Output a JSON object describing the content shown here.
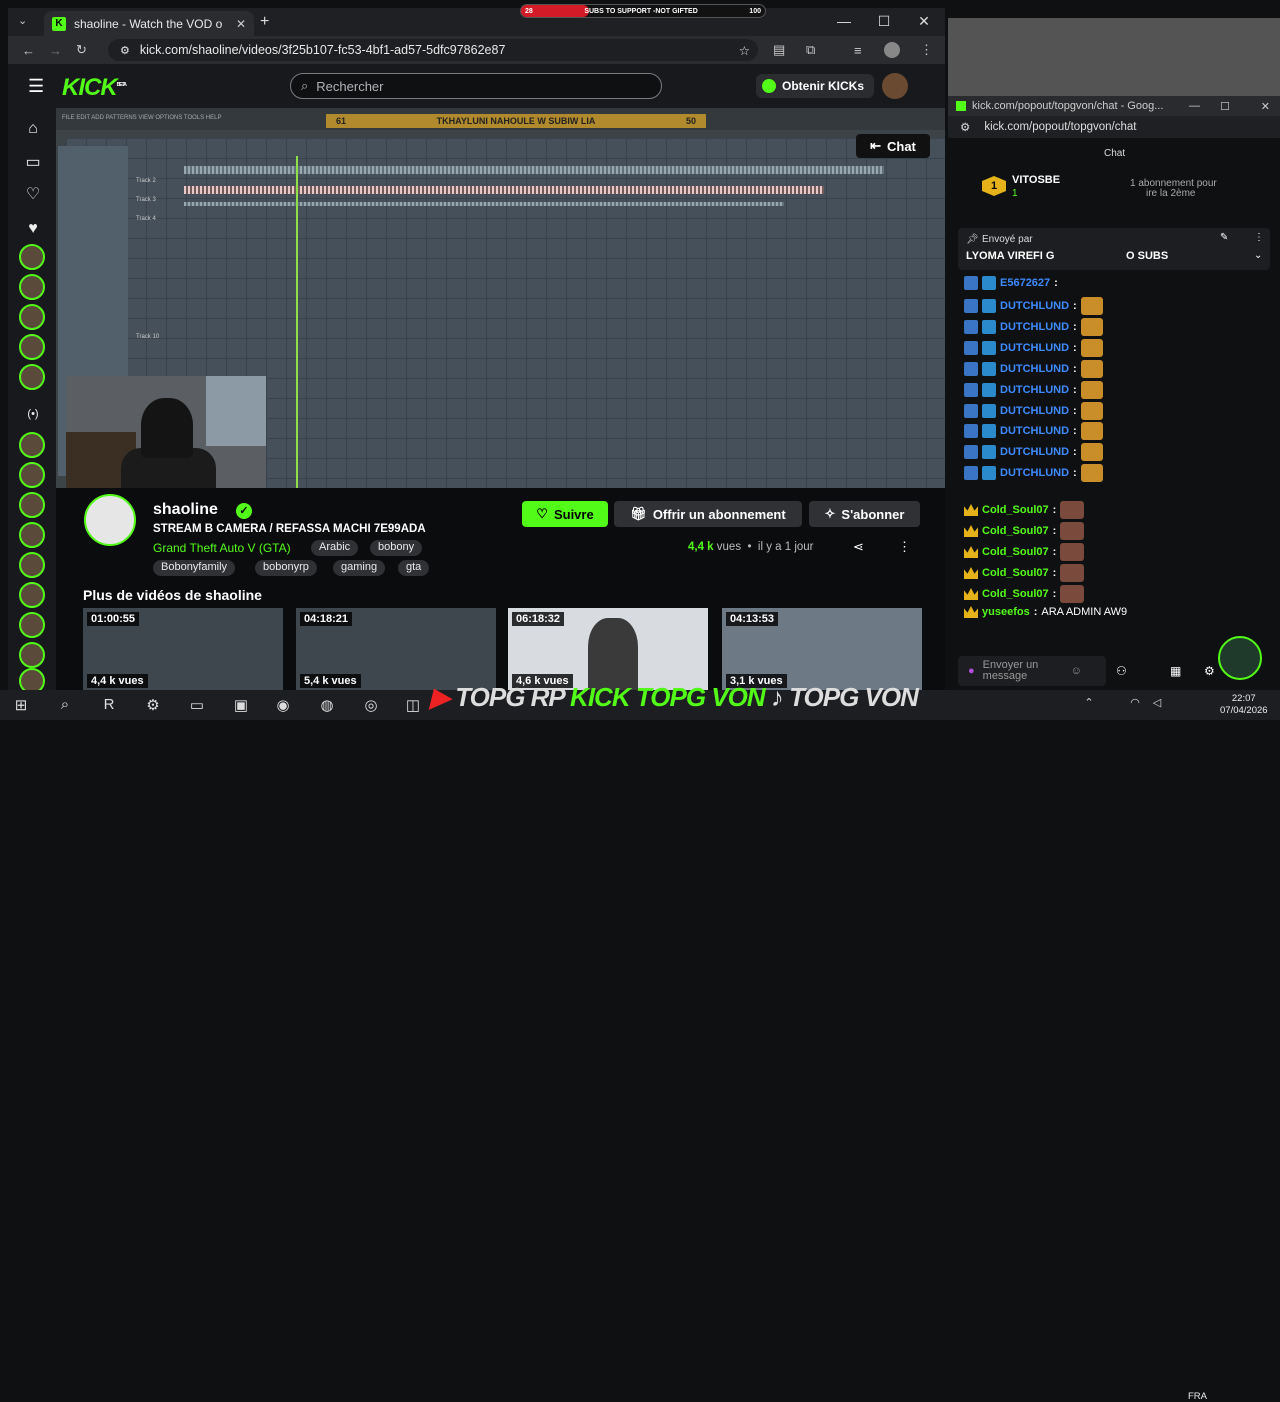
{
  "overlay": {
    "sub_goal_left": "28",
    "sub_goal_text": "SUBS TO SUPPORT -NOT GIFTED",
    "sub_goal_right": "100",
    "sub_progress": 0.28
  },
  "browser": {
    "tab_title": "shaoline - Watch the VOD o",
    "url": "kick.com/shaoline/videos/3f25b107-fc53-4bf1-ad57-5dfc97862e87"
  },
  "kick": {
    "logo": "KICK",
    "logo_beta": "BETA",
    "search_placeholder": "Rechercher",
    "get_kicks": "Obtenir KICKs"
  },
  "video": {
    "banner_left": "61",
    "banner_text": "TKHAYLUNI NAHOULE W SUBIW LIA",
    "banner_right": "50",
    "chat_button": "Chat",
    "track_labels": [
      "Track 2",
      "Track 3",
      "Track 4",
      "Track 10"
    ]
  },
  "channel": {
    "name": "shaoline",
    "stream_title": "STREAM B CAMERA / REFASSA MACHI 7E99ADA",
    "game": "Grand Theft Auto V (GTA)",
    "tags_row1": [
      "Arabic",
      "bobony"
    ],
    "tags_row2": [
      "Bobonyfamily",
      "bobonyrp",
      "gaming",
      "gta"
    ],
    "follow": "Suivre",
    "gift_sub": "Offrir un abonnement",
    "subscribe": "S'abonner",
    "views": "4,4 k",
    "views_label": "vues",
    "age": "il y a 1 jour"
  },
  "more_videos": {
    "title": "Plus de vidéos de shaoline",
    "items": [
      {
        "duration": "01:00:55",
        "views": "4,4 k vues"
      },
      {
        "duration": "04:18:21",
        "views": "5,4 k vues"
      },
      {
        "duration": "06:18:32",
        "views": "4,6 k vues"
      },
      {
        "duration": "04:13:53",
        "views": "3,1 k vues"
      }
    ]
  },
  "chat": {
    "tab_title": "kick.com/popout/topgvon/chat - Goog...",
    "url": "kick.com/popout/topgvon/chat",
    "top_user": "VITOSBE",
    "top_user_count": "1",
    "top_badge_num": "1",
    "sub_note": "1 abonnement pour",
    "sub_note2": "ire la 2ème",
    "pinned_by": "Envoyé par",
    "pinned_msg": "LYOMA VIREFI G",
    "pinned_msg2": "O SUBS",
    "overlay_chat": "Chat",
    "messages": [
      {
        "user": "E5672627",
        "type": "blue",
        "emote": false,
        "text": ""
      },
      {
        "user": "DUTCHLUND",
        "type": "blue",
        "emote": true,
        "text": ""
      },
      {
        "user": "DUTCHLUND",
        "type": "blue",
        "emote": true,
        "text": ""
      },
      {
        "user": "DUTCHLUND",
        "type": "blue",
        "emote": true,
        "text": ""
      },
      {
        "user": "DUTCHLUND",
        "type": "blue",
        "emote": true,
        "text": ""
      },
      {
        "user": "DUTCHLUND",
        "type": "blue",
        "emote": true,
        "text": ""
      },
      {
        "user": "DUTCHLUND",
        "type": "blue",
        "emote": true,
        "text": ""
      },
      {
        "user": "DUTCHLUND",
        "type": "blue",
        "emote": true,
        "text": ""
      },
      {
        "user": "DUTCHLUND",
        "type": "blue",
        "emote": true,
        "text": ""
      },
      {
        "user": "DUTCHLUND",
        "type": "blue",
        "emote": true,
        "text": ""
      },
      {
        "user": "Cold_Soul07",
        "type": "gold",
        "emote": true,
        "text": ""
      },
      {
        "user": "Cold_Soul07",
        "type": "gold",
        "emote": true,
        "text": ""
      },
      {
        "user": "Cold_Soul07",
        "type": "gold",
        "emote": true,
        "text": ""
      },
      {
        "user": "Cold_Soul07",
        "type": "gold",
        "emote": true,
        "text": ""
      },
      {
        "user": "Cold_Soul07",
        "type": "gold",
        "emote": true,
        "text": ""
      },
      {
        "user": "yuseefos",
        "type": "gold",
        "emote": false,
        "text": "ARA ADMIN AW9"
      }
    ],
    "input_placeholder": "Envoyer un message"
  },
  "taskbar": {
    "social_text_1": "TOPG RP",
    "social_text_2": "KICK",
    "social_text_3": "TOPG VON",
    "social_text_4": "TOPG VON",
    "lang": "FRA",
    "time": "22:07",
    "date": "07/04/2026"
  },
  "colors": {
    "kick_green": "#53fc18",
    "sub_red": "#d21b26",
    "blue_user": "#3d8bff"
  }
}
